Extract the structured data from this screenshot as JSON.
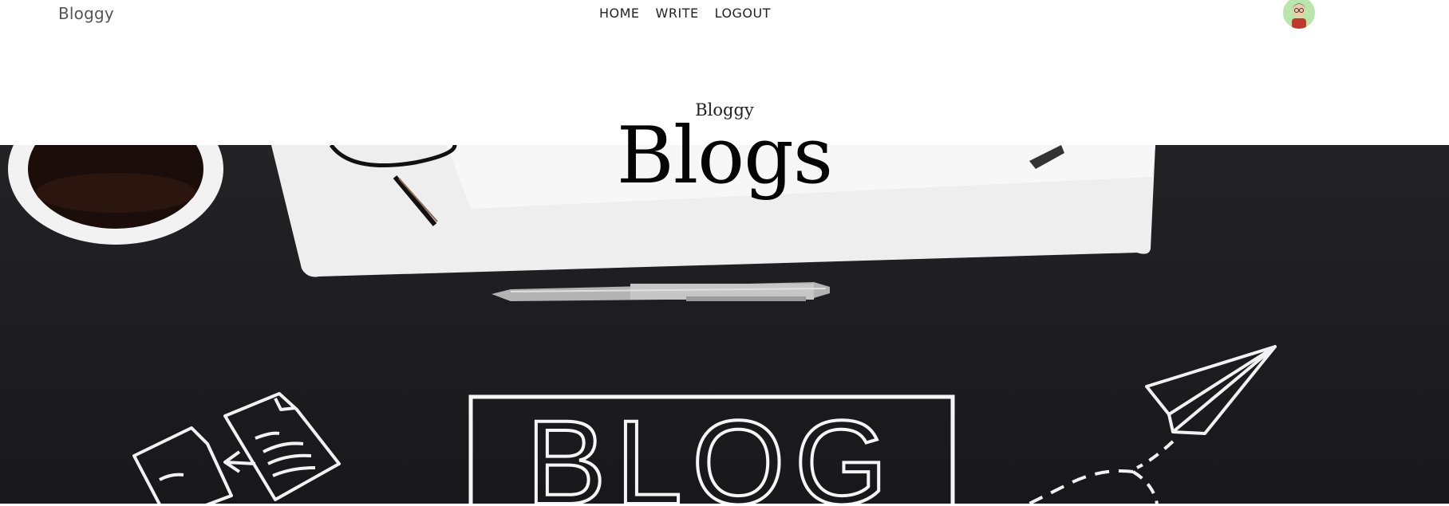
{
  "brand": "Bloggy",
  "nav": {
    "home": "HOME",
    "write": "WRITE",
    "logout": "LOGOUT"
  },
  "header": {
    "title_small": "Bloggy",
    "title_large": "Blogs"
  },
  "hero": {
    "sign_text": "BLOG"
  },
  "colors": {
    "hero_background": "#1a1a1c",
    "avatar_background": "#b9e6ad"
  },
  "icons": [
    "user-avatar-icon",
    "coffee-cup-icon",
    "eyeglasses-icon",
    "pen-icon",
    "documents-icon",
    "paper-plane-icon"
  ]
}
